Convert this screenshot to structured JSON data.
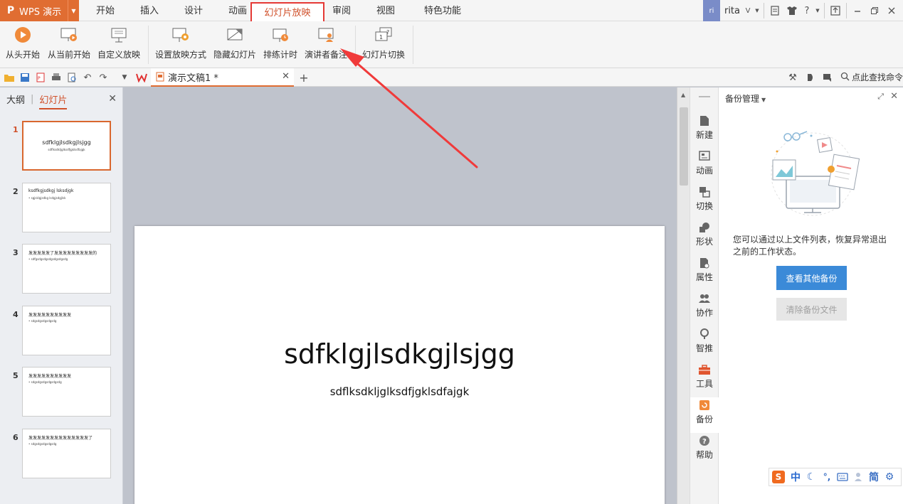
{
  "app": {
    "logo": "P",
    "name": "WPS 演示"
  },
  "menu": {
    "tabs": [
      {
        "label": "开始"
      },
      {
        "label": "插入"
      },
      {
        "label": "设计"
      },
      {
        "label": "动画"
      },
      {
        "label": "幻灯片放映"
      },
      {
        "label": "审阅"
      },
      {
        "label": "视图"
      },
      {
        "label": "特色功能"
      }
    ],
    "active_tab": "幻灯片放映"
  },
  "user": {
    "avatar": "ri",
    "name": "rita",
    "help": "?"
  },
  "ribbon": {
    "from_start": "从头开始",
    "from_current": "从当前开始",
    "custom_show": "自定义放映",
    "setup_show": "设置放映方式",
    "hide_slide": "隐藏幻灯片",
    "rehearse": "排练计时",
    "presenter_notes": "演讲者备注",
    "transition": "幻灯片切换"
  },
  "doc_tab": {
    "title": "演示文稿1 *"
  },
  "search_cmd": "点此查找命令",
  "left_pane": {
    "tab_outline": "大纲",
    "tab_slides": "幻灯片",
    "slides": [
      {
        "num": "1",
        "title": "sdfklgjlsdkgjlsjgg",
        "body": "sdflksdkljglksdfjgklsdfajgk"
      },
      {
        "num": "2",
        "title": "ksdfkgjsdkgj lsksdjgk",
        "body": "• sgjsklgjsdkg lsdgjsdgjlsk"
      },
      {
        "num": "3",
        "title": "发发发发发了发发发发发发发发发的",
        "body": "• sdfgsdgsdgsdgsdgsdgsdg"
      },
      {
        "num": "4",
        "title": "发发发发发发发发发发",
        "body": "• sdgsdgsdgsdgsdg"
      },
      {
        "num": "5",
        "title": "发发发发发发发发发发",
        "body": "• sdgsdgsdgsdgsdgsdg"
      },
      {
        "num": "6",
        "title": "发发发发发发发发发发发发发发了",
        "body": "• sdgsdgsdgsdgsdg"
      }
    ]
  },
  "slide": {
    "title": "sdfklgjlsdkgjlsjgg",
    "subtitle": "sdflksdkljglksdfjgklsdfajgk"
  },
  "right_strip": {
    "items": [
      {
        "label": "新建",
        "icon": "new-doc-icon"
      },
      {
        "label": "动画",
        "icon": "animation-icon"
      },
      {
        "label": "切换",
        "icon": "switch-icon"
      },
      {
        "label": "形状",
        "icon": "shape-icon"
      },
      {
        "label": "属性",
        "icon": "properties-icon"
      },
      {
        "label": "协作",
        "icon": "collaborate-icon"
      },
      {
        "label": "智推",
        "icon": "recommend-icon"
      },
      {
        "label": "工具",
        "icon": "toolbox-icon"
      },
      {
        "label": "备份",
        "icon": "backup-icon"
      },
      {
        "label": "帮助",
        "icon": "help-icon"
      }
    ]
  },
  "backup": {
    "title": "备份管理",
    "message": "您可以通过以上文件列表，恢复异常退出之前的工作状态。",
    "view_other": "查看其他备份",
    "clear_files": "清除备份文件"
  },
  "ime": {
    "lang": "中",
    "mode": "简"
  },
  "colors": {
    "accent": "#e06d32",
    "active_red": "#e53935",
    "button_blue": "#3b8ad8",
    "annotation": "#f03a3a"
  }
}
